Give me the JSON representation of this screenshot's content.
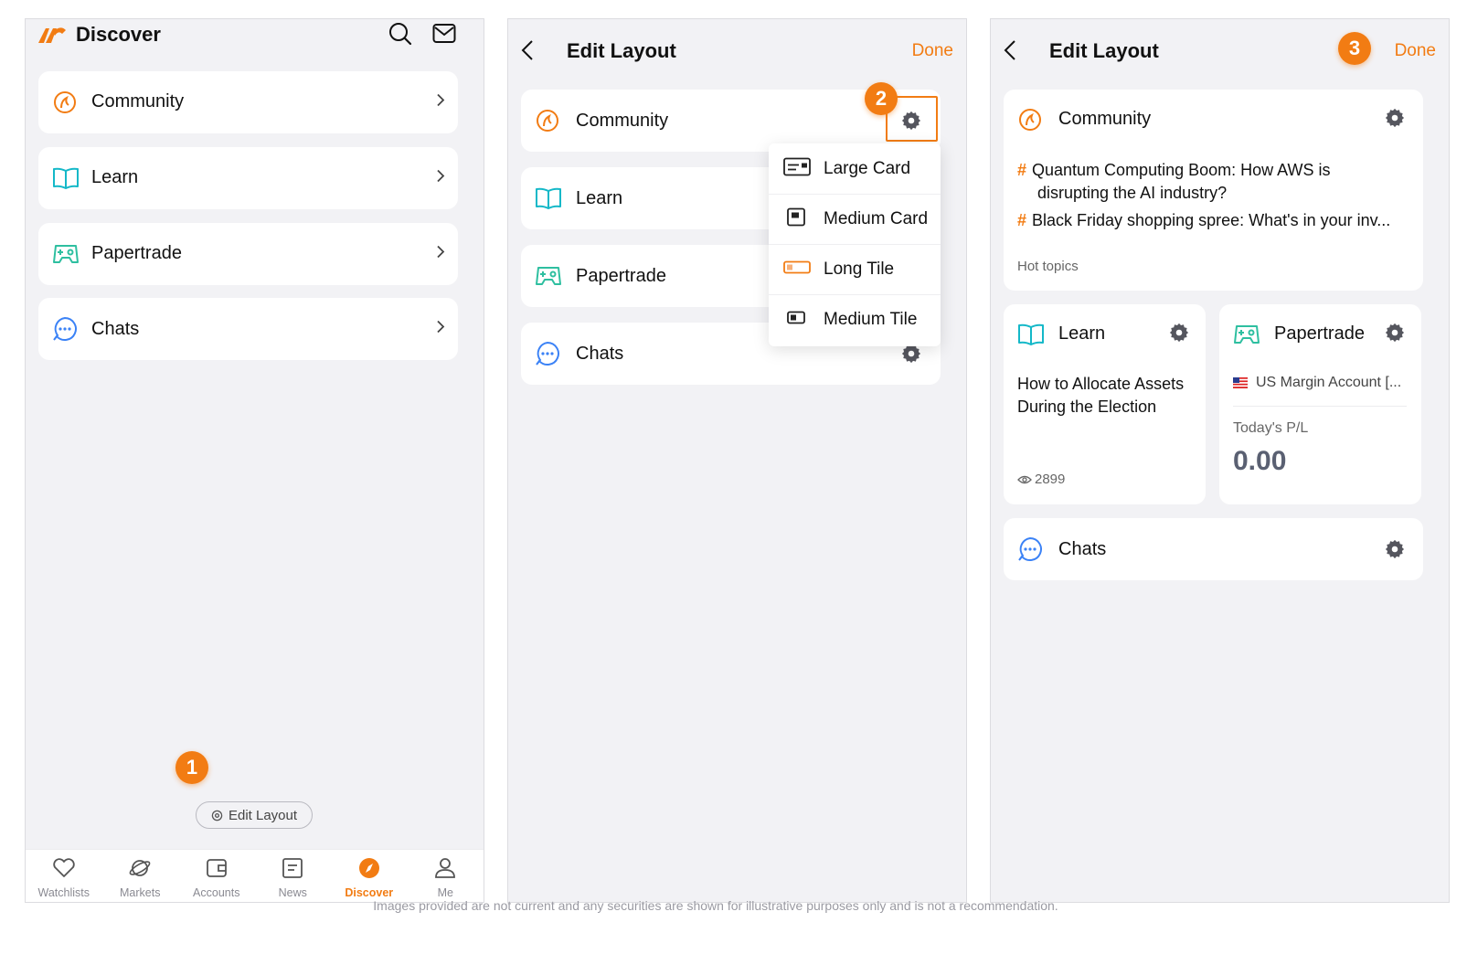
{
  "colors": {
    "accent": "#f27c13",
    "learn": "#14b8c8",
    "papertrade": "#2ebfa0",
    "chats": "#3b82f6",
    "gear": "#55565e"
  },
  "screen1": {
    "title": "Discover",
    "items": [
      {
        "label": "Community",
        "icon": "community-icon"
      },
      {
        "label": "Learn",
        "icon": "book-icon"
      },
      {
        "label": "Papertrade",
        "icon": "gamepad-icon"
      },
      {
        "label": "Chats",
        "icon": "chat-bubble-icon"
      }
    ],
    "edit_layout_label": "Edit Layout",
    "step_badge": "1",
    "tabs": [
      {
        "label": "Watchlists",
        "icon": "heart-icon"
      },
      {
        "label": "Markets",
        "icon": "planet-icon"
      },
      {
        "label": "Accounts",
        "icon": "wallet-icon"
      },
      {
        "label": "News",
        "icon": "news-icon"
      },
      {
        "label": "Discover",
        "icon": "compass-icon",
        "active": true
      },
      {
        "label": "Me",
        "icon": "person-icon"
      }
    ]
  },
  "screen2": {
    "title": "Edit Layout",
    "done_label": "Done",
    "step_badge": "2",
    "items": [
      {
        "label": "Community"
      },
      {
        "label": "Learn"
      },
      {
        "label": "Papertrade"
      },
      {
        "label": "Chats"
      }
    ],
    "menu": [
      {
        "label": "Large Card",
        "icon": "large-card-icon"
      },
      {
        "label": "Medium Card",
        "icon": "medium-card-icon"
      },
      {
        "label": "Long Tile",
        "icon": "long-tile-icon"
      },
      {
        "label": "Medium Tile",
        "icon": "medium-tile-icon"
      }
    ]
  },
  "screen3": {
    "title": "Edit Layout",
    "done_label": "Done",
    "step_badge": "3",
    "community": {
      "label": "Community",
      "topics": [
        "Quantum Computing Boom: How AWS is",
        "disrupting the AI industry?",
        "Black Friday shopping spree: What's in your inv..."
      ],
      "hashtag": "#",
      "footer": "Hot topics"
    },
    "learn": {
      "label": "Learn",
      "line1": "How to Allocate Assets",
      "line2": "During the Election",
      "views": "2899"
    },
    "papertrade": {
      "label": "Papertrade",
      "account": "US Margin Account [...",
      "pl_label": "Today's P/L",
      "pl_value": "0.00"
    },
    "chats": {
      "label": "Chats"
    }
  },
  "footer": "Images provided are not current and any securities are shown for illustrative purposes only and is not a recommendation."
}
